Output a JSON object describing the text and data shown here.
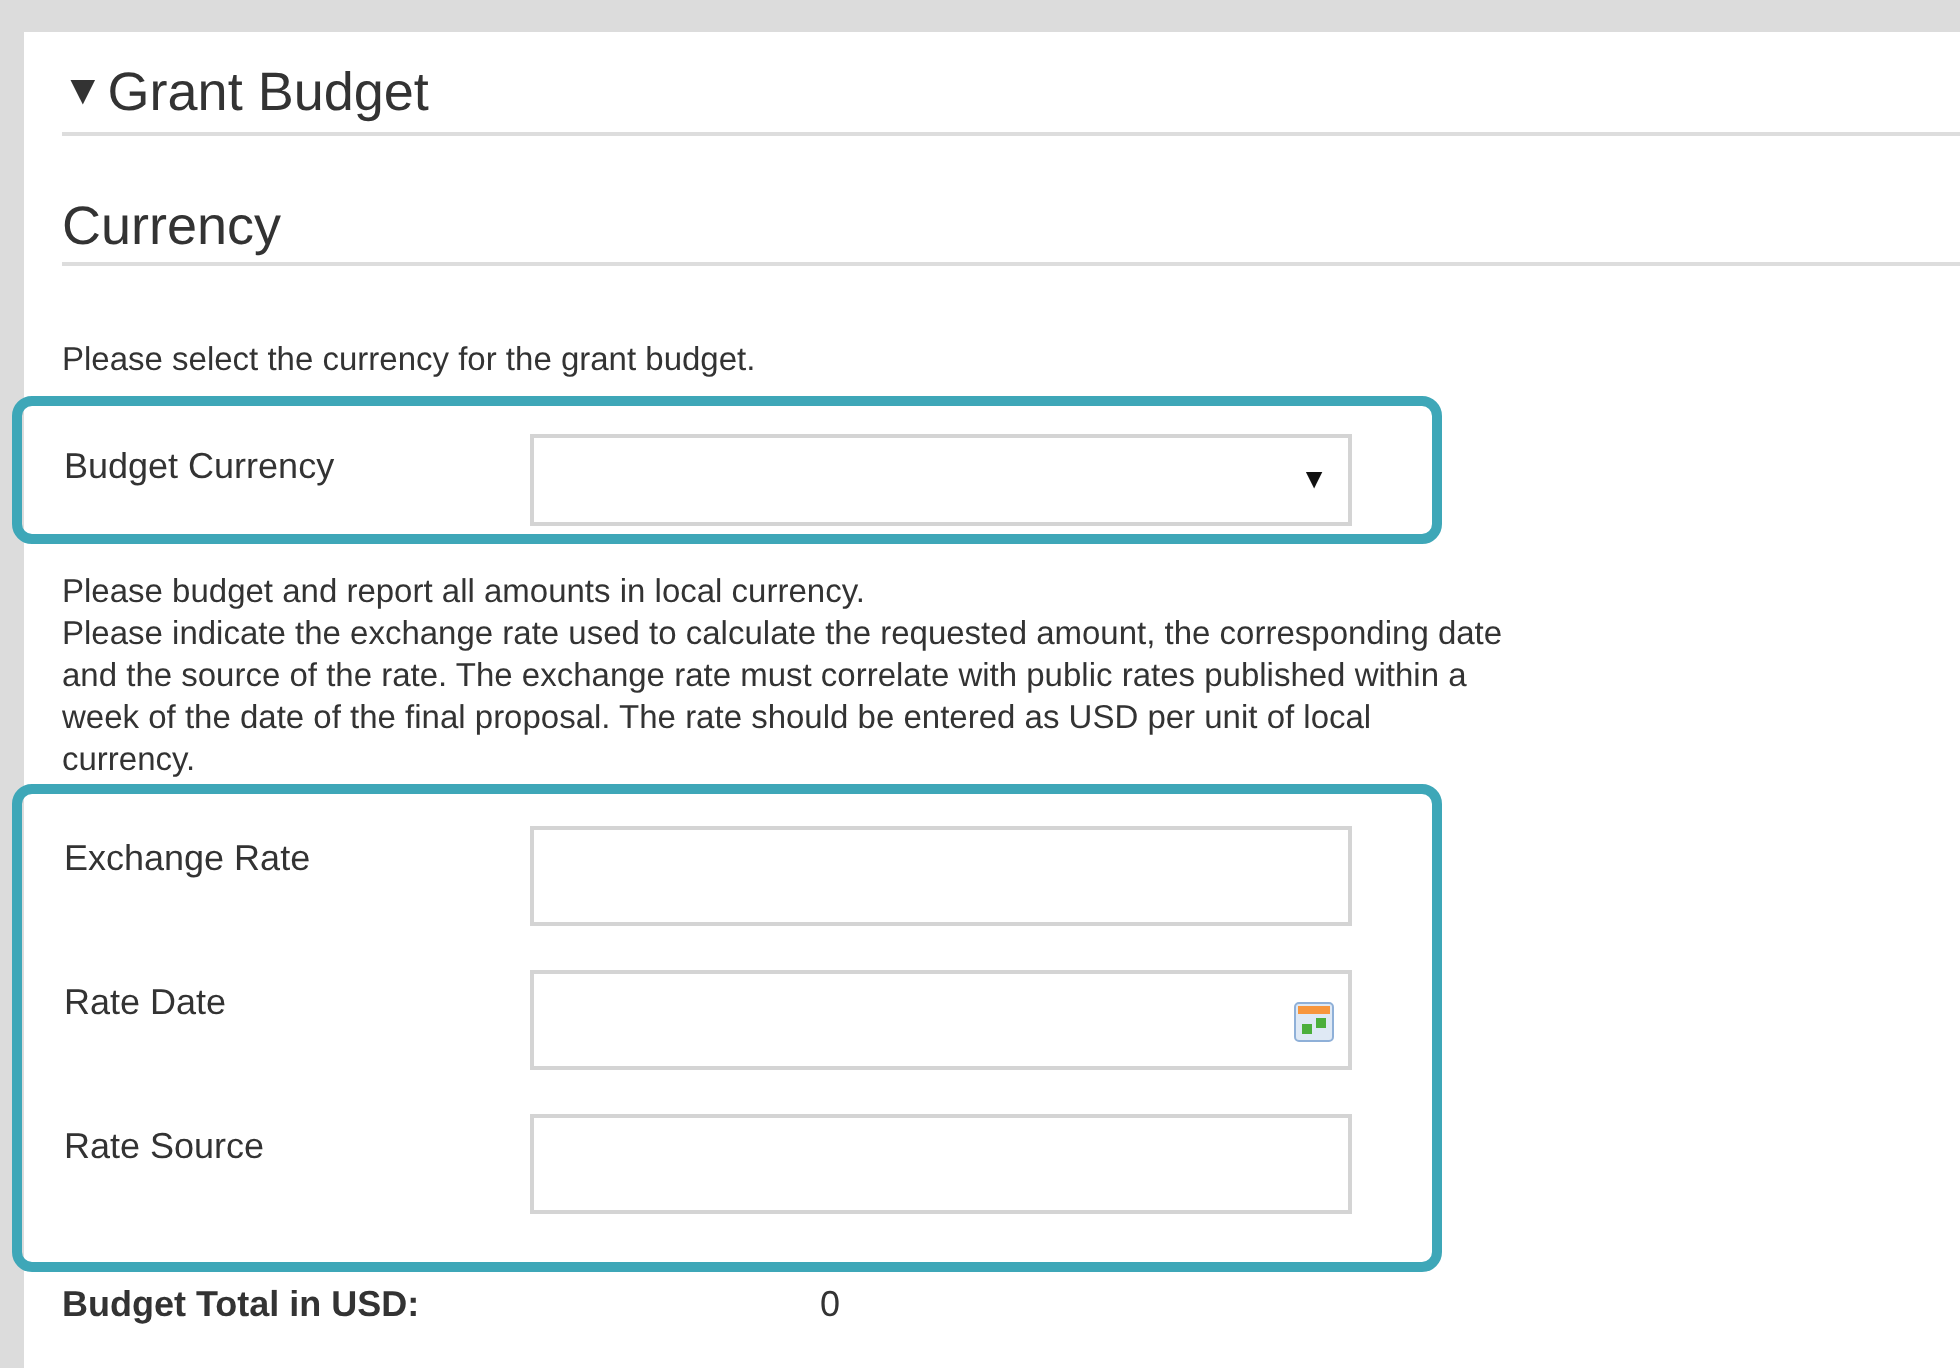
{
  "section": {
    "toggle": "▼",
    "title": "Grant Budget",
    "expanded": true
  },
  "subsection": {
    "title": "Currency"
  },
  "intro": "Please select the currency for the grant budget.",
  "currency_field": {
    "label": "Budget Currency",
    "caret": "▼"
  },
  "notes": [
    "Please budget and report all amounts in local currency.",
    "Please indicate the exchange rate used to calculate the requested amount, the corresponding date",
    "and the source of the rate. The exchange rate must correlate with public rates published within a",
    "week of the date of the final proposal.  The rate should be entered as USD per unit of local",
    "currency."
  ],
  "rate_fields": [
    {
      "label": "Exchange Rate",
      "kind": "text"
    },
    {
      "label": "Rate Date",
      "kind": "date"
    },
    {
      "label": "Rate Source",
      "kind": "text"
    }
  ],
  "total": {
    "label": "Budget Total in USD:",
    "value": "0"
  }
}
